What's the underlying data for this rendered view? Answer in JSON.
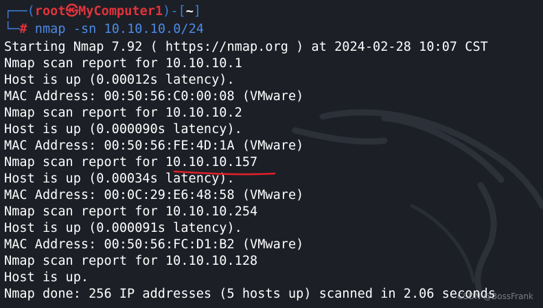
{
  "prompt": {
    "box_top": "┌──(",
    "user_host": "root㉿MyComputer1",
    "mid": ")-[",
    "cwd": "~",
    "close": "]",
    "box_bottom": "└─",
    "hash": "#",
    "command": "nmap",
    "args": "-sn 10.10.10.0/24"
  },
  "output": [
    "Starting Nmap 7.92 ( https://nmap.org ) at 2024-02-28 10:07 CST",
    "Nmap scan report for 10.10.10.1",
    "Host is up (0.00012s latency).",
    "MAC Address: 00:50:56:C0:00:08 (VMware)",
    "Nmap scan report for 10.10.10.2",
    "Host is up (0.000090s latency).",
    "MAC Address: 00:50:56:FE:4D:1A (VMware)",
    "Nmap scan report for 10.10.10.157",
    "Host is up (0.00034s latency).",
    "MAC Address: 00:0C:29:E6:48:58 (VMware)",
    "Nmap scan report for 10.10.10.254",
    "Host is up (0.000091s latency).",
    "MAC Address: 00:50:56:FC:D1:B2 (VMware)",
    "Nmap scan report for 10.10.10.128",
    "Host is up.",
    "Nmap done: 256 IP addresses (5 hosts up) scanned in 2.06 seconds"
  ],
  "watermark": "CSDN @BossFrank",
  "colors": {
    "background": "#1c1f26",
    "prompt_box": "#3f7dd7",
    "user_host": "#e2333b",
    "args": "#4c8be6",
    "underline": "#e0202a"
  }
}
